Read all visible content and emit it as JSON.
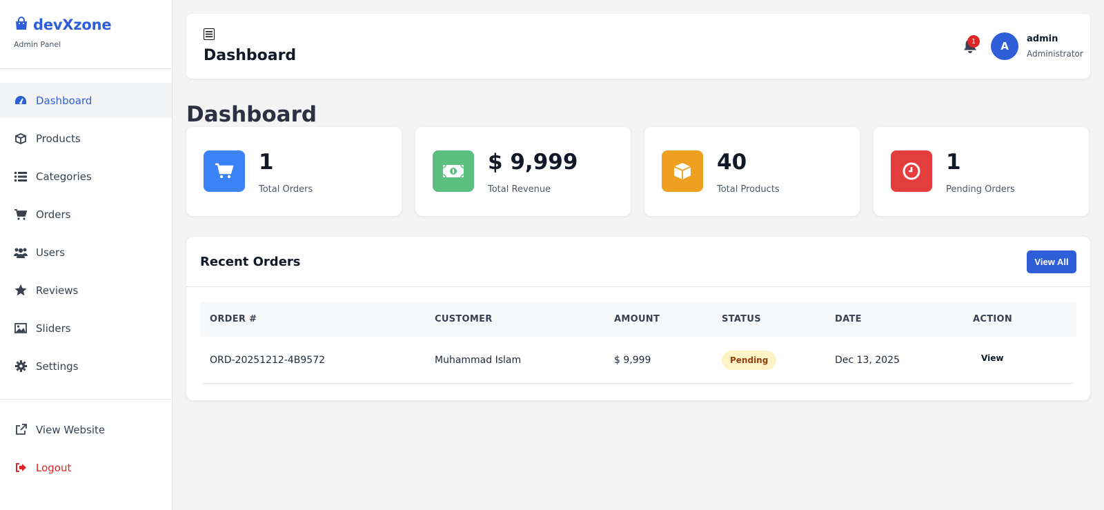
{
  "brand": {
    "name": "devXzone",
    "subtitle": "Admin Panel",
    "color": "#2f5fd8"
  },
  "sidebar": {
    "items": [
      {
        "label": "Dashboard",
        "icon": "dashboard-icon",
        "active": true
      },
      {
        "label": "Products",
        "icon": "box-icon"
      },
      {
        "label": "Categories",
        "icon": "list-icon"
      },
      {
        "label": "Orders",
        "icon": "cart-icon"
      },
      {
        "label": "Users",
        "icon": "users-icon"
      },
      {
        "label": "Reviews",
        "icon": "star-icon"
      },
      {
        "label": "Sliders",
        "icon": "image-icon"
      },
      {
        "label": "Settings",
        "icon": "gear-icon"
      }
    ],
    "footer": [
      {
        "label": "View Website",
        "icon": "external-link-icon"
      },
      {
        "label": "Logout",
        "icon": "logout-icon",
        "color": "#dc2626"
      }
    ]
  },
  "topbar": {
    "title": "Dashboard",
    "notification_count": "1",
    "user": {
      "initial": "A",
      "name": "admin",
      "role": "Administrator"
    }
  },
  "page": {
    "title": "Dashboard"
  },
  "stats": [
    {
      "value": "1",
      "label": "Total Orders",
      "icon": "cart-icon",
      "color": "#3b82f6"
    },
    {
      "value": "$ 9,999",
      "label": "Total Revenue",
      "icon": "money-icon",
      "color": "#5bbf7f"
    },
    {
      "value": "40",
      "label": "Total Products",
      "icon": "box-icon",
      "color": "#f0a020"
    },
    {
      "value": "1",
      "label": "Pending Orders",
      "icon": "clock-icon",
      "color": "#e43d3d"
    }
  ],
  "recent_orders": {
    "title": "Recent Orders",
    "view_all_label": "View All",
    "columns": [
      "ORDER #",
      "CUSTOMER",
      "AMOUNT",
      "STATUS",
      "DATE",
      "ACTION"
    ],
    "rows": [
      {
        "order": "ORD-20251212-4B9572",
        "customer": "Muhammad Islam",
        "amount": "$ 9,999",
        "status": "Pending",
        "date": "Dec 13, 2025",
        "action": "View"
      }
    ]
  }
}
